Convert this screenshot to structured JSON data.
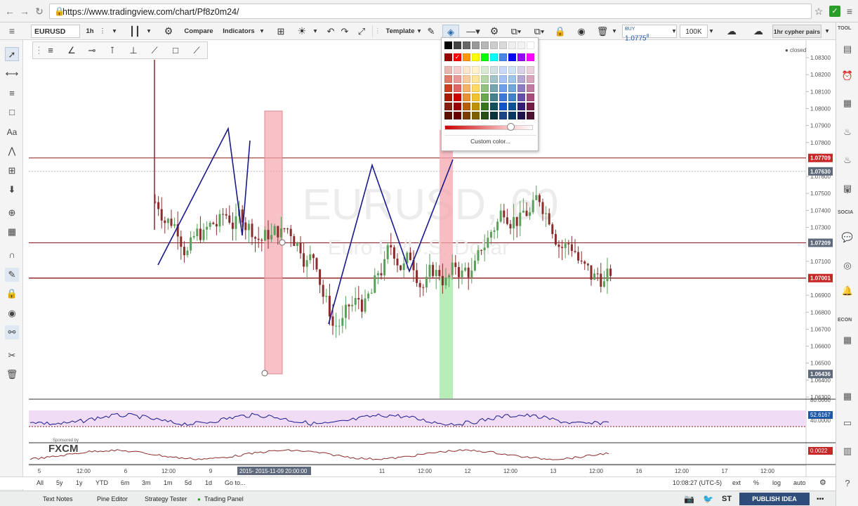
{
  "browser": {
    "url": "https://www.tradingview.com/chart/Pf8z0m24/"
  },
  "toolbar": {
    "symbol": "EURUSD",
    "interval": "1h",
    "compare": "Compare",
    "indicators": "Indicators",
    "template": "Template",
    "buy_label": "BUY",
    "buy_price": "1.0775",
    "buy_price_sup": "8",
    "quantity": "100K",
    "layout_name": "1hr cypher pairs"
  },
  "right_panel": {
    "tools_label": "TOOL",
    "social_label": "SOCIA",
    "econ_label": "ECON"
  },
  "chart": {
    "status": "closed",
    "watermark_title": "EURUSD, 60",
    "watermark_subtitle": "Euro Fx/U.S. Dollar",
    "sponsored": "Sponsored by",
    "broker_logo": "FXCM",
    "price_levels": [
      "1.08300",
      "1.08200",
      "1.08100",
      "1.08000",
      "1.07900",
      "1.07800",
      "1.07600",
      "1.07500",
      "1.07400",
      "1.07300",
      "1.07100",
      "1.06900",
      "1.06800",
      "1.06700",
      "1.06600",
      "1.06500",
      "1.06400",
      "1.06300"
    ],
    "price_badges": [
      {
        "text": "1.07709",
        "color": "#c62828"
      },
      {
        "text": "1.07630",
        "color": "#5f6a7d"
      },
      {
        "text": "1.07209",
        "color": "#5f6a7d"
      },
      {
        "text": "1.07001",
        "color": "#c62828"
      },
      {
        "text": "1.06436",
        "color": "#5f6a7d"
      }
    ],
    "rsi": {
      "top": "80.0000",
      "value": "52.6167",
      "bottom": "40.0000"
    },
    "macd_value": "0.0022",
    "time_labels": [
      "5",
      "12:00",
      "6",
      "12:00",
      "9",
      "12:00",
      "11",
      "12:00",
      "12",
      "12:00",
      "13",
      "12:00",
      "16",
      "12:00",
      "17",
      "12:00"
    ],
    "crosshair_time": "2015-11-09 20:00:00",
    "crosshair_prefix": "2015-"
  },
  "bottom_bar": {
    "ranges": [
      "All",
      "5y",
      "1y",
      "YTD",
      "6m",
      "3m",
      "1m",
      "5d",
      "1d"
    ],
    "goto": "Go to...",
    "clock": "10:08:27 (UTC-5)",
    "ext": "ext",
    "pct": "%",
    "log": "log",
    "auto": "auto"
  },
  "footer": {
    "tabs": [
      "Text Notes",
      "Pine Editor",
      "Strategy Tester",
      "Trading Panel"
    ],
    "st_label": "ST",
    "publish": "PUBLISH IDEA"
  },
  "color_picker": {
    "custom": "Custom color...",
    "top_row": [
      "#000000",
      "#444444",
      "#666666",
      "#999999",
      "#b7b7b7",
      "#cccccc",
      "#d9d9d9",
      "#efefef",
      "#f3f3f3",
      "#ffffff"
    ],
    "bright_row": [
      "#980000",
      "#ff0000",
      "#ff9900",
      "#ffff00",
      "#00ff00",
      "#00ffff",
      "#4a86e8",
      "#0000ff",
      "#9900ff",
      "#ff00ff"
    ],
    "rows": [
      [
        "#e6b8af",
        "#f4cccc",
        "#fce5cd",
        "#fff2cc",
        "#d9ead3",
        "#d0e0e3",
        "#c9daf8",
        "#cfe2f3",
        "#d9d2e9",
        "#ead1dc"
      ],
      [
        "#dd7e6b",
        "#ea9999",
        "#f9cb9c",
        "#ffe599",
        "#b6d7a8",
        "#a2c4c9",
        "#a4c2f4",
        "#9fc5e8",
        "#b4a7d6",
        "#d5a6bd"
      ],
      [
        "#cc4125",
        "#e06666",
        "#f6b26b",
        "#ffd966",
        "#93c47d",
        "#76a5af",
        "#6d9eeb",
        "#6fa8dc",
        "#8e7cc3",
        "#c27ba0"
      ],
      [
        "#a61c00",
        "#cc0000",
        "#e69138",
        "#f1c232",
        "#6aa84f",
        "#45818e",
        "#3c78d8",
        "#3d85c6",
        "#674ea7",
        "#a64d79"
      ],
      [
        "#85200c",
        "#990000",
        "#b45f06",
        "#bf9000",
        "#38761d",
        "#134f5c",
        "#1155cc",
        "#0b5394",
        "#351c75",
        "#741b47"
      ],
      [
        "#5b0f00",
        "#660000",
        "#783f04",
        "#7f6000",
        "#274e13",
        "#0c343d",
        "#1c4587",
        "#073763",
        "#20124d",
        "#4c1130"
      ]
    ]
  }
}
